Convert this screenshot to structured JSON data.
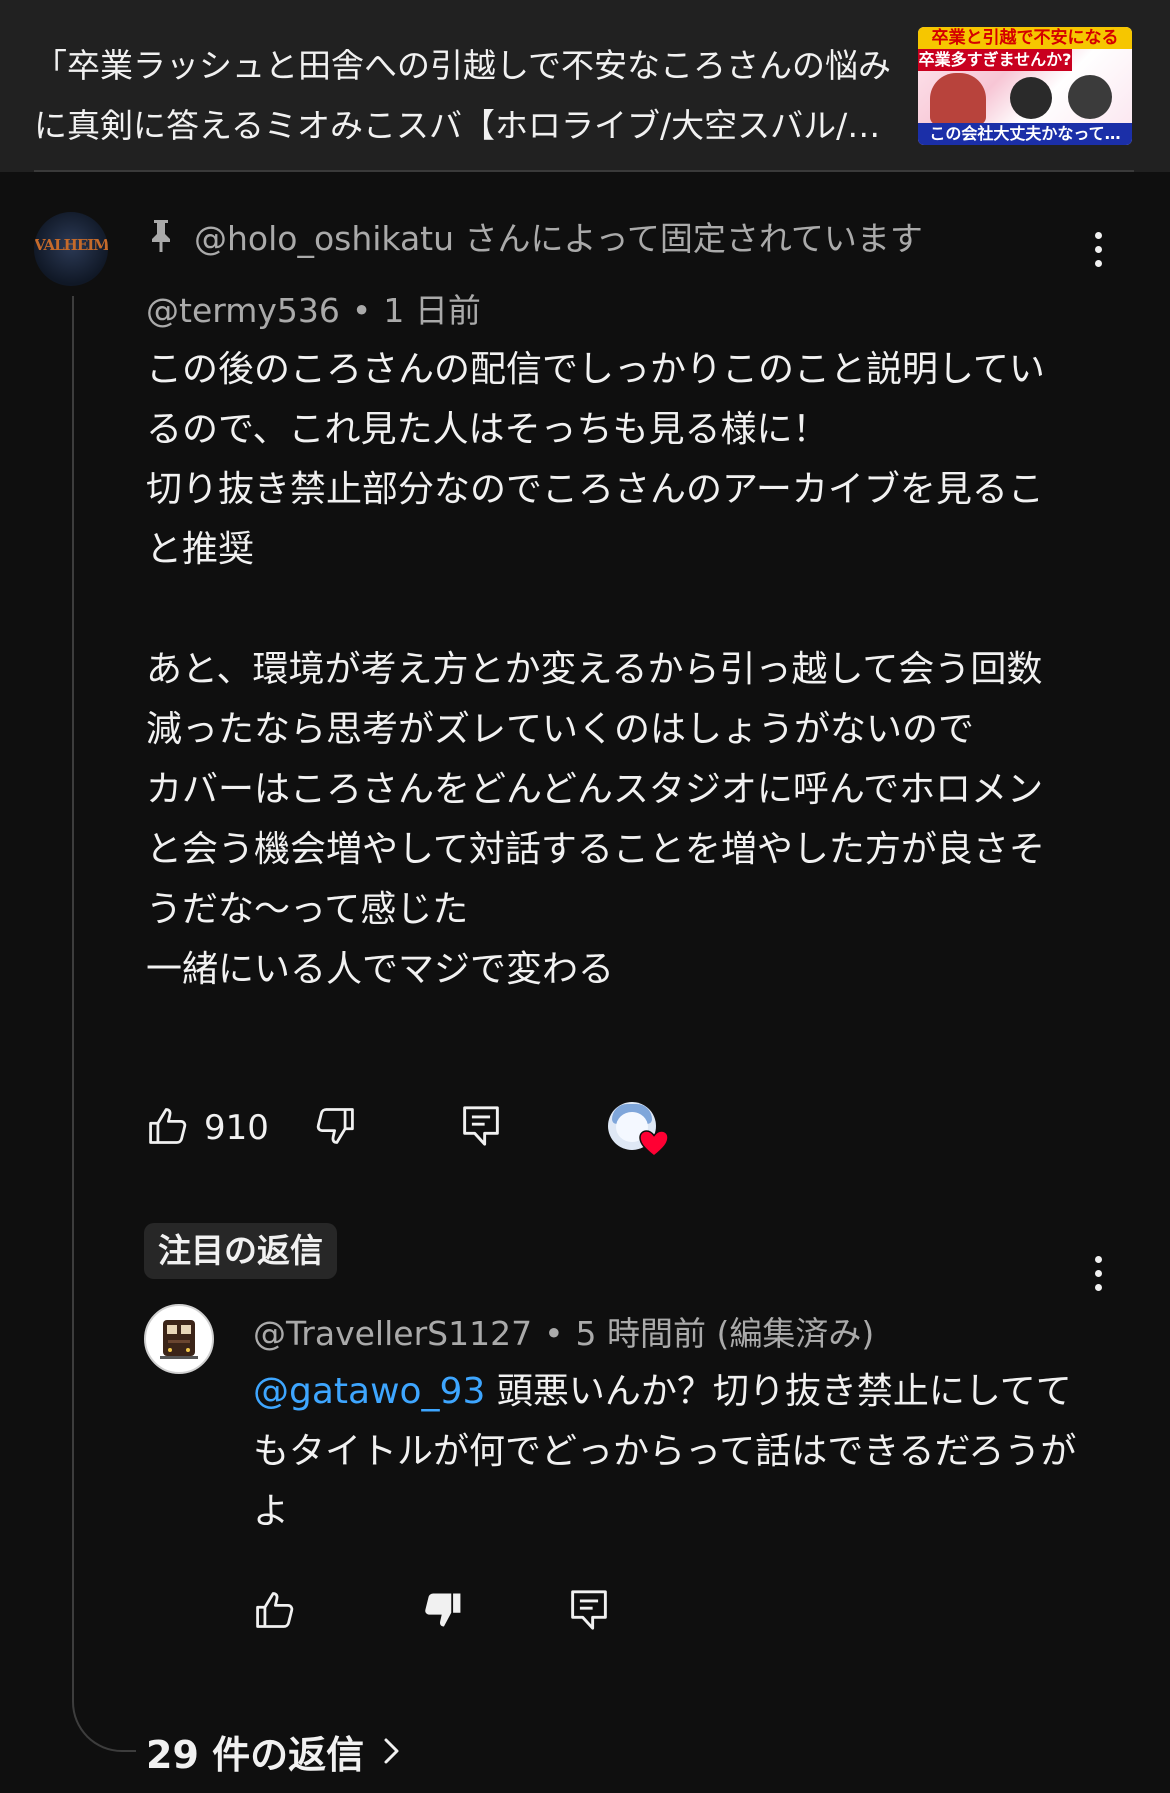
{
  "video": {
    "title": "「卒業ラッシュと田舎への引越しで不安なころさんの悩みに真剣に答えるミオみこスバ【ホロライブ/大空スバル/…",
    "thumbnail": {
      "line1": "卒業と引越で不安になる",
      "line2": "卒業多すぎませんか?",
      "line3": "この会社大丈夫かなって…"
    }
  },
  "comment": {
    "avatar_text": "VALHEIM",
    "pinned_text": "@holo_oshikatu さんによって固定されています",
    "author": "@termy536",
    "separator": "•",
    "time": "1 日前",
    "body": "この後のころさんの配信でしっかりこのこと説明しているので、これ見た人はそっちも見る様に！\n切り抜き禁止部分なのでころさんのアーカイブを見ること推奨\n\nあと、環境が考え方とか変えるから引っ越して会う回数減ったなら思考がズレていくのはしょうがないので\nカバーはころさんをどんどんスタジオに呼んでホロメンと会う機会増やして対話することを増やした方が良さそうだな〜って感じた\n一緒にいる人でマジで変わる",
    "like_count": "910",
    "icons": [
      "pin-icon",
      "more-vert-icon",
      "thumb-up-icon",
      "thumb-down-icon",
      "reply-icon",
      "creator-heart-icon"
    ]
  },
  "highlighted_reply": {
    "chip_label": "注目の返信",
    "author": "@TravellerS1127",
    "separator": "•",
    "time": "5 時間前",
    "edited": "(編集済み)",
    "mention": "@gatawo_93",
    "body": " 頭悪いんか？切り抜き禁止にしててもタイトルが何でどっからって話はできるだろうがよ",
    "icons": [
      "more-vert-icon",
      "thumb-up-icon",
      "thumb-down-filled-icon",
      "reply-icon"
    ]
  },
  "replies_link": {
    "label": "29 件の返信"
  },
  "colors": {
    "background": "#0f0f0f",
    "header_bg": "#212121",
    "secondary_text": "#aaaaaa",
    "mention": "#3ea6ff",
    "heart": "#ff0033"
  }
}
